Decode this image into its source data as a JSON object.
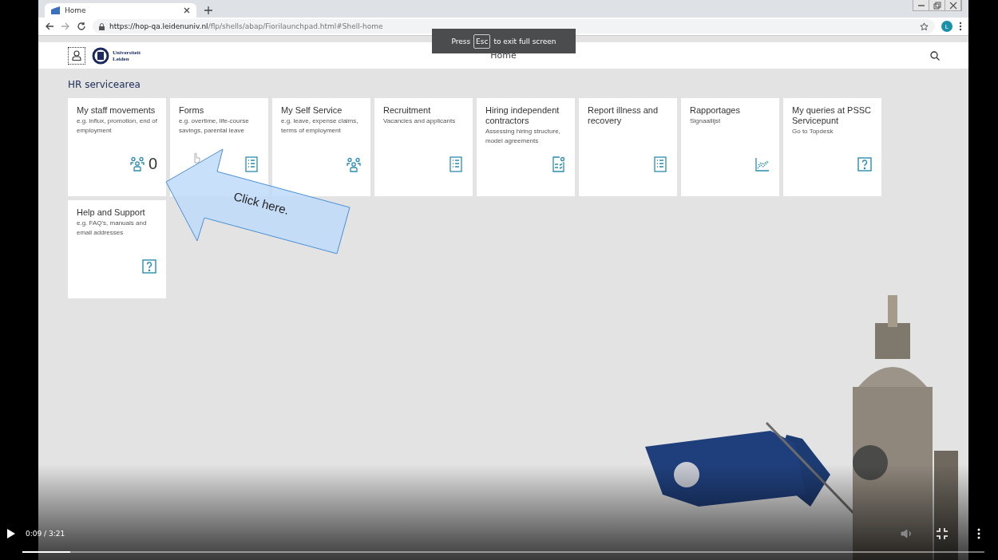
{
  "browser": {
    "tab": {
      "title": "Home"
    },
    "url": {
      "host": "https://hop-qa.leidenuniv.nl",
      "path": "/flp/shells/abap/Fiorilaunchpad.html#Shell-home"
    },
    "profile_initial": "L"
  },
  "fullscreen_notice": {
    "before": "Press",
    "key": "Esc",
    "after": "to exit full screen"
  },
  "shell": {
    "logo_lines": [
      "Universiteit",
      "Leiden"
    ],
    "title": "Home"
  },
  "group": {
    "title": "HR servicearea",
    "tiles": [
      {
        "title": "My staff movements",
        "subtitle": "e.g. influx, promotion, end of employment",
        "kind": "people",
        "count": "0"
      },
      {
        "title": "Forms",
        "subtitle": "e.g. overtime, life-course savings, parental leave",
        "kind": "list"
      },
      {
        "title": "My Self Service",
        "subtitle": "e.g. leave, expense claims, terms of employment",
        "kind": "people"
      },
      {
        "title": "Recruitment",
        "subtitle": "Vacancies and applicants",
        "kind": "list"
      },
      {
        "title": "Hiring independent contractors",
        "subtitle": "Assessing hiring structure, model agreements",
        "kind": "checkdoc"
      },
      {
        "title": "Report illness and recovery",
        "kind": "list"
      },
      {
        "title": "Rapportages",
        "subtitle": "Signaallijst",
        "kind": "chart"
      },
      {
        "title": "My queries at PSSC Servicepunt",
        "subtitle": "Go to Topdesk",
        "kind": "help"
      },
      {
        "title": "Help and Support",
        "subtitle": "e.g. FAQ's, manuals and email addresses",
        "kind": "help"
      }
    ]
  },
  "callout": {
    "text": "Click here."
  },
  "player": {
    "time": "0:09 / 3:21",
    "level": 0.05
  }
}
